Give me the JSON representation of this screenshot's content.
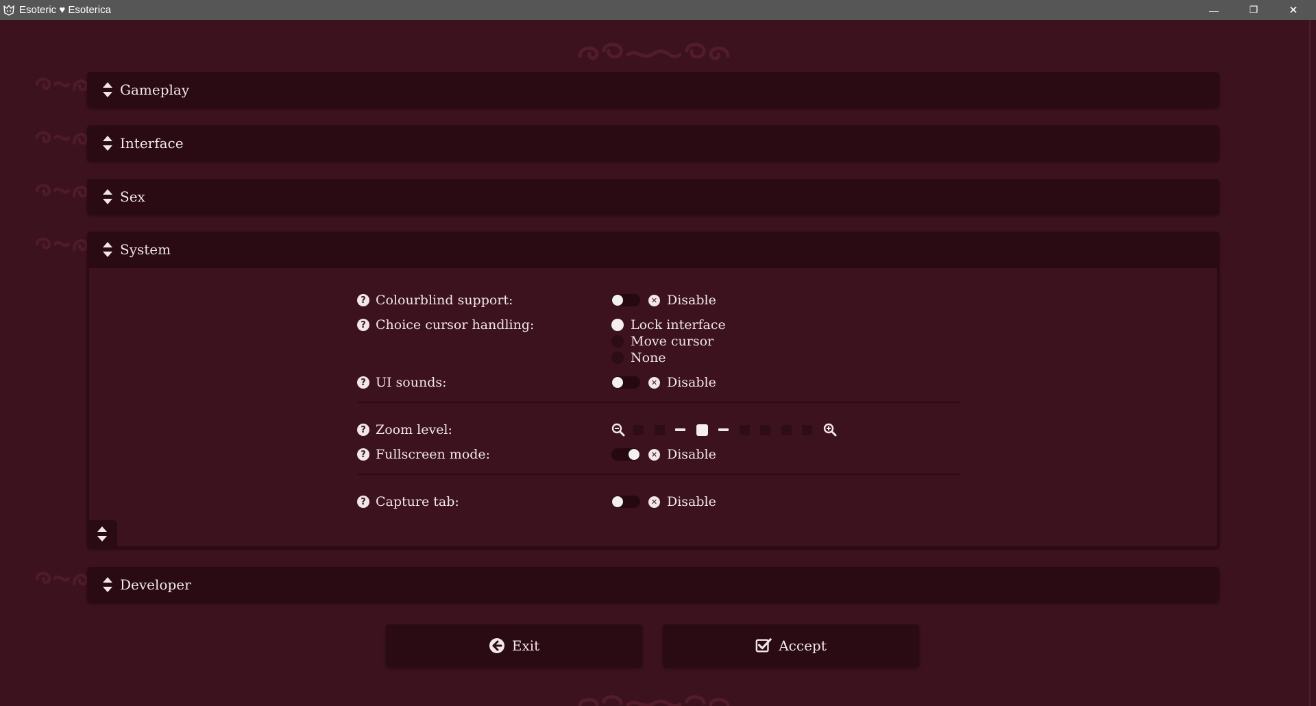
{
  "window": {
    "title": "Esoteric ♥ Esoterica",
    "minimize_glyph": "—",
    "restore_glyph": "❐",
    "close_glyph": "✕"
  },
  "sections": {
    "gameplay": "Gameplay",
    "interface": "Interface",
    "sex": "Sex",
    "system": "System",
    "developer": "Developer"
  },
  "system": {
    "colourblind": {
      "label": "Colourblind support:",
      "value": "Disable",
      "enabled": false
    },
    "choice_cursor": {
      "label": "Choice cursor handling:",
      "options": [
        "Lock interface",
        "Move cursor",
        "None"
      ],
      "selected": "Lock interface"
    },
    "ui_sounds": {
      "label": "UI sounds:",
      "value": "Disable",
      "enabled": false
    },
    "zoom": {
      "label": "Zoom level:",
      "current_step": 4,
      "total_steps": 11
    },
    "fullscreen": {
      "label": "Fullscreen mode:",
      "value": "Disable",
      "enabled": false
    },
    "capture_tab": {
      "label": "Capture tab:",
      "value": "Disable",
      "enabled": false
    }
  },
  "buttons": {
    "exit": "Exit",
    "accept": "Accept"
  },
  "icons": {
    "section": "sort-chevrons-icon",
    "help": "question-circle-icon",
    "disable": "x-circle-icon",
    "zoom_out": "zoom-out-icon",
    "zoom_in": "zoom-in-icon",
    "exit": "arrow-left-circle-icon",
    "accept": "check-square-icon"
  },
  "colors": {
    "background": "#3b121d",
    "panel": "#2a0a13",
    "text": "#f1e6ea",
    "titlebar": "#565656"
  }
}
